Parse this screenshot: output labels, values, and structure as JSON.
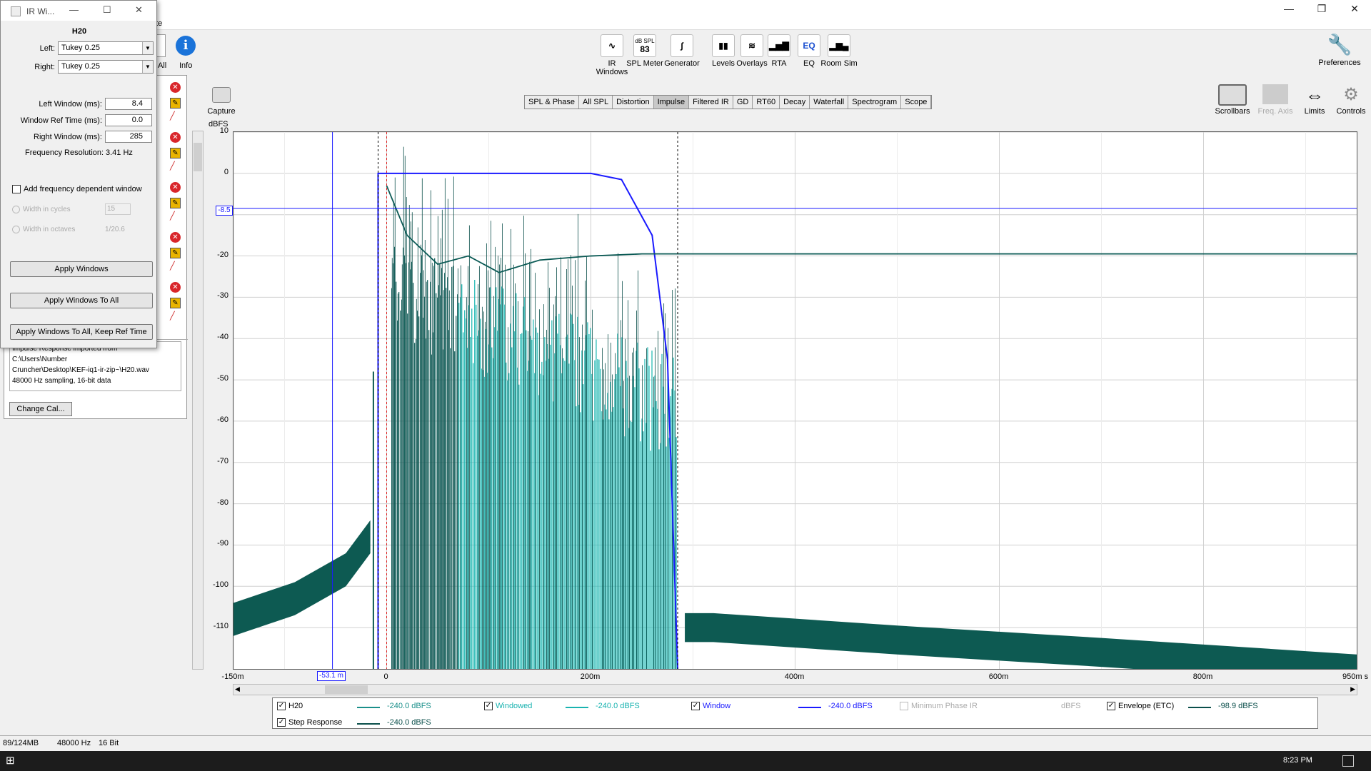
{
  "dialog": {
    "title": "IR Wi...",
    "heading": "H20",
    "left_label": "Left:",
    "left_value": "Tukey 0.25",
    "right_label": "Right:",
    "right_value": "Tukey 0.25",
    "left_window_label": "Left Window (ms):",
    "left_window_value": "8.4",
    "ref_time_label": "Window Ref Time (ms):",
    "ref_time_value": "0.0",
    "right_window_label": "Right Window (ms):",
    "right_window_value": "285",
    "freq_res_label": "Frequency Resolution:",
    "freq_res_value": "3.41 Hz",
    "freq_dep_label": "Add frequency dependent window",
    "cycles_label": "Width in cycles",
    "cycles_value": "15",
    "octaves_label": "Width in octaves",
    "octaves_value": "1/20.6",
    "apply_btn": "Apply Windows",
    "apply_all_btn": "Apply Windows To All",
    "apply_all_keep_btn": "Apply Windows To All, Keep Ref Time"
  },
  "menu": {
    "partial_item": "ate"
  },
  "left_toolbar": {
    "all_label": "All",
    "info_label": "Info"
  },
  "toolbar": [
    {
      "label": "IR Windows",
      "glyph": "∿"
    },
    {
      "label": "SPL Meter",
      "glyph": "83",
      "sub": "dB SPL"
    },
    {
      "label": "Generator",
      "glyph": "∫"
    },
    {
      "label": "Levels",
      "glyph": "▮▮"
    },
    {
      "label": "Overlays",
      "glyph": "≋"
    },
    {
      "label": "RTA",
      "glyph": "▂▅▇"
    },
    {
      "label": "EQ",
      "glyph": "EQ"
    },
    {
      "label": "Room Sim",
      "glyph": "▂▆▄"
    }
  ],
  "right_tools": [
    {
      "label": "Preferences"
    },
    {
      "label": "Scrollbars"
    },
    {
      "label": "Freq. Axis"
    },
    {
      "label": "Limits"
    },
    {
      "label": "Controls"
    }
  ],
  "capture_label": "Capture",
  "tabs": [
    "SPL & Phase",
    "All SPL",
    "Distortion",
    "Impulse",
    "Filtered IR",
    "GD",
    "RT60",
    "Decay",
    "Waterfall",
    "Spectrogram",
    "Scope"
  ],
  "active_tab": "Impulse",
  "notes": {
    "lines": [
      "Impulse Response imported from",
      "C:\\Users\\Number",
      "Cruncher\\Desktop\\KEF-iq1-ir-zip~\\H20.wav",
      "48000 Hz sampling, 16-bit data"
    ],
    "change_cal": "Change Cal..."
  },
  "plot": {
    "y_unit": "dBFS",
    "cursor_y": "-8.5",
    "cursor_x": "-53.1 m",
    "x_end_label": "950m s"
  },
  "chart_data": {
    "type": "line",
    "ylabel": "dBFS",
    "ylim": [
      -120,
      10
    ],
    "yticks": [
      10,
      0,
      -10,
      -20,
      -30,
      -40,
      -50,
      -60,
      -70,
      -80,
      -90,
      -100,
      -110
    ],
    "ytick_labels": [
      "10",
      "0",
      "-10",
      "-20",
      "-30",
      "-40",
      "-50",
      "-60",
      "-70",
      "-80",
      "-90",
      "-100",
      "-110"
    ],
    "xlim": [
      -150,
      950
    ],
    "xticks": [
      -150,
      0,
      200,
      400,
      600,
      800
    ],
    "xtick_labels": [
      "-150m",
      "0",
      "200m",
      "400m",
      "600m",
      "800m"
    ],
    "series": [
      {
        "name": "Window",
        "color": "#1a1aff",
        "x": [
          -8.4,
          -8.4,
          -5,
          0,
          150,
          200,
          230,
          260,
          275,
          285
        ],
        "y": [
          -120,
          0,
          0,
          0,
          0,
          0,
          -1.5,
          -15,
          -45,
          -120
        ]
      },
      {
        "name": "Envelope (ETC)",
        "color": "#0b5a55",
        "x": [
          0,
          20,
          50,
          80,
          110,
          150,
          200,
          250,
          285,
          950
        ],
        "y": [
          -3,
          -15,
          -22,
          -20,
          -24,
          -21,
          -20,
          -19.5,
          -19.5,
          -19.5
        ]
      },
      {
        "name": "Step Response",
        "color": "#0d5a52",
        "x": [
          -150,
          -50,
          -20,
          -10,
          290,
          400,
          600,
          800,
          950
        ],
        "y": [
          -107,
          -100,
          -93,
          -90,
          -108,
          -110,
          -114,
          -118,
          -120
        ]
      }
    ],
    "cursor": {
      "x": -53.1,
      "y": -8.5
    }
  },
  "legend": [
    {
      "label": "H20",
      "checked": true,
      "value": "-240.0 dBFS",
      "color": "#1a8f8a",
      "dim": false
    },
    {
      "label": "Windowed",
      "checked": true,
      "value": "-240.0 dBFS",
      "color": "#19b3b0",
      "dim": false
    },
    {
      "label": "Window",
      "checked": true,
      "value": "-240.0 dBFS",
      "color": "#1a1aff",
      "dim": false
    },
    {
      "label": "Minimum Phase IR",
      "checked": false,
      "value": "dBFS",
      "color": "#aaaaaa",
      "dim": true
    },
    {
      "label": "Envelope (ETC)",
      "checked": true,
      "value": "-98.9 dBFS",
      "color": "#0b4f4b",
      "dim": false
    },
    {
      "label": "Step Response",
      "checked": true,
      "value": "-240.0 dBFS",
      "color": "#0b4f4b",
      "dim": false
    }
  ],
  "status": {
    "memory": "89/124MB",
    "rate": "48000 Hz",
    "bits": "16 Bit"
  },
  "taskbar": {
    "time": "8:23 PM"
  }
}
